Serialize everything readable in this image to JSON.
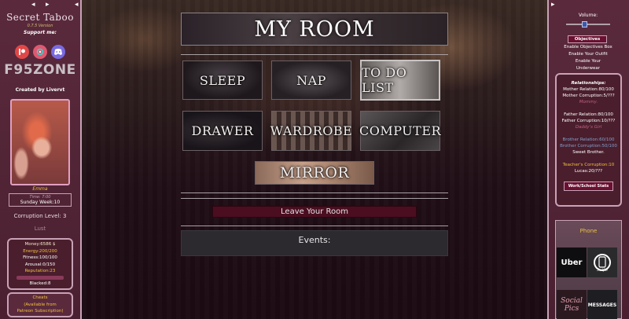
{
  "left_sidebar": {
    "game_title": "Secret Taboo",
    "version": "0.7.5 Version",
    "support_label": "Support me:",
    "f95_logo": "F95ZONE",
    "created_by": "Created by Livervt",
    "character_name": "Emma",
    "time": "Time: 7:00",
    "week": "Sunday Week:10",
    "corruption_level": "Corruption Level: 3",
    "lust_label": "Lust",
    "stats": [
      {
        "text": "Money:6586 $",
        "color": "#f0e8c8"
      },
      {
        "text": "Energy:200/200",
        "color": "#f0c040"
      },
      {
        "text": "Fitness:100/100",
        "color": "#ffffff"
      },
      {
        "text": "Arousal:0/150",
        "color": "#ffffff"
      },
      {
        "text": "Reputation:23",
        "color": "#f0c040"
      }
    ],
    "blacked": "Blacked:8",
    "cheats": [
      "Cheats",
      "(Available from",
      "Patreon Subscription)"
    ],
    "icons": [
      "patreon-icon",
      "subscribestar-icon",
      "discord-icon"
    ]
  },
  "main": {
    "title": "MY ROOM",
    "buttons": {
      "sleep": "SLEEP",
      "nap": "NAP",
      "todo": "TO DO LIST",
      "drawer": "DRAWER",
      "wardrobe": "WARDROBE",
      "computer": "COMPUTER",
      "mirror": "MIRROR"
    },
    "leave": "Leave Your Room",
    "events_title": "Events:"
  },
  "right_sidebar": {
    "volume_label": "Volume:",
    "volume_level": 0.4,
    "objectives": "Objectives",
    "links": [
      "Enable Objectives Box",
      "Enable Your Outfit",
      "Enable Your",
      "Underwear"
    ],
    "relationships_title": "Relationships:",
    "relationships": [
      {
        "text": "Mother Relation:80/100",
        "color": "#ffffff"
      },
      {
        "text": "Mother Corruption:5/???",
        "color": "#ffffff"
      },
      {
        "text": "Mommy.",
        "color": "#c06080",
        "italic": true
      },
      {
        "gap": true
      },
      {
        "text": "Father Relation:80/100",
        "color": "#ffffff"
      },
      {
        "text": "Father Corruption:10/???",
        "color": "#ffffff"
      },
      {
        "text": "Daddy's Girl",
        "color": "#c06080",
        "italic": true
      },
      {
        "gap": true
      },
      {
        "text": "Brother Relation:60/100",
        "color": "#80a0d0"
      },
      {
        "text": "Brother Corruption:50/100",
        "color": "#80a0d0"
      },
      {
        "text": "Sweet Brother.",
        "color": "#ffffff"
      },
      {
        "gap": true
      },
      {
        "text": "Teacher's Corruption:10",
        "color": "#f0c040"
      },
      {
        "text": "Lucas:20/???",
        "color": "#ffffff"
      }
    ],
    "work_stats": "Work/School Stats",
    "phone_label": "Phone",
    "apps": {
      "uber": "Uber",
      "selfie": "Selfie",
      "social_pics": "Social Pics",
      "messages": "MESSAGES"
    }
  }
}
